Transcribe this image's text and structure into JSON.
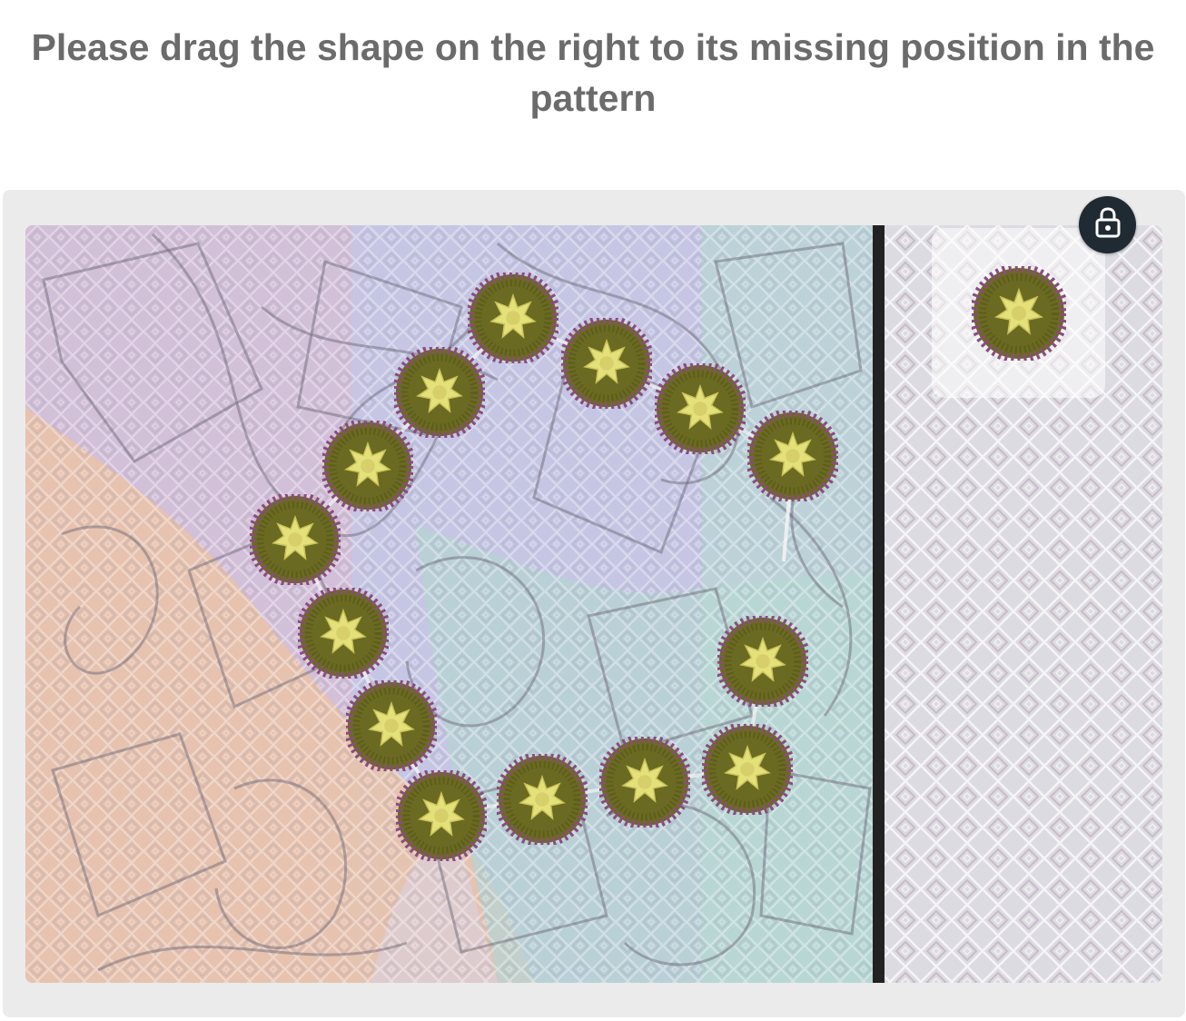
{
  "instruction": {
    "line1": "Please drag the shape on the right to its missing position in the",
    "line2": "pattern"
  },
  "icons": {
    "lock": "lock-icon",
    "piece": "sun-token-icon"
  },
  "colors": {
    "text": "#6b6b6b",
    "frame": "#ebebeb",
    "lock_button": "#1f2a33",
    "divider": "#222222",
    "token_outer": "#6b6a22",
    "token_accent": "#8a4c7e",
    "token_center": "#e4e07a"
  }
}
